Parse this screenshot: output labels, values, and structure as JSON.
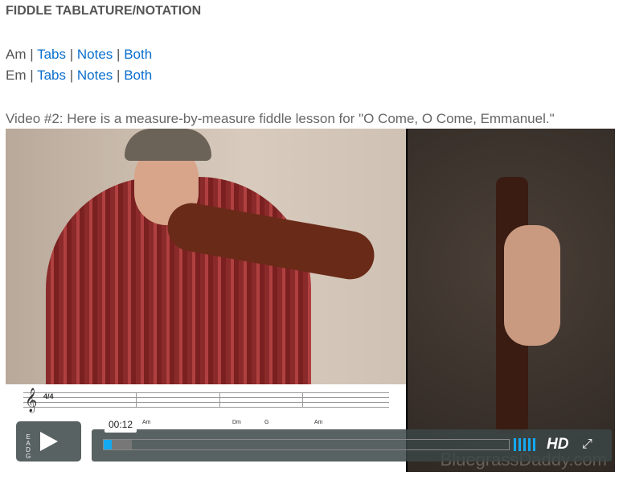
{
  "heading": "FIDDLE TABLATURE/NOTATION",
  "keys": [
    {
      "key": "Am",
      "tabs": "Tabs",
      "notes": "Notes",
      "both": "Both"
    },
    {
      "key": "Em",
      "tabs": "Tabs",
      "notes": "Notes",
      "both": "Both"
    }
  ],
  "separator": "|",
  "caption": "Video #2: Here is a measure-by-measure fiddle lesson for \"O Come, O Come, Emmanuel.\"",
  "video": {
    "watermark": "BluegrassDaddy.com",
    "time": "00:12",
    "hd": "HD",
    "progress_pct": 2,
    "buffered_pct": 7,
    "accent": "#14a9f0",
    "sheet": {
      "time_sig": "4/4",
      "chords": [
        "Am",
        "Dm",
        "G",
        "Am"
      ],
      "strings": "E A D G",
      "measures": [
        "1",
        "2",
        "3",
        "4"
      ]
    }
  }
}
